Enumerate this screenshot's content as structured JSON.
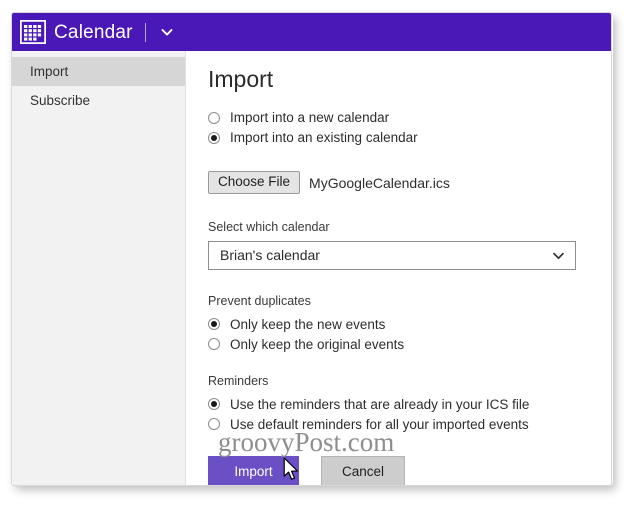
{
  "header": {
    "icon": "calendar-icon",
    "title": "Calendar",
    "caret": "chevron-down-icon"
  },
  "sidebar": {
    "items": [
      {
        "label": "Import",
        "selected": true
      },
      {
        "label": "Subscribe",
        "selected": false
      }
    ]
  },
  "main": {
    "heading": "Import",
    "import_target": {
      "options": [
        {
          "label": "Import into a new calendar",
          "selected": false
        },
        {
          "label": "Import into an existing calendar",
          "selected": true
        }
      ]
    },
    "file": {
      "button_label": "Choose File",
      "file_name": "MyGoogleCalendar.ics"
    },
    "calendar_select": {
      "label": "Select which calendar",
      "value": "Brian's calendar",
      "chevron": "chevron-down-icon"
    },
    "prevent_duplicates": {
      "label": "Prevent duplicates",
      "options": [
        {
          "label": "Only keep the new events",
          "selected": true
        },
        {
          "label": "Only keep the original events",
          "selected": false
        }
      ]
    },
    "reminders": {
      "label": "Reminders",
      "options": [
        {
          "label": "Use the reminders that are already in your ICS file",
          "selected": true
        },
        {
          "label": "Use default reminders for all your imported events",
          "selected": false
        }
      ]
    },
    "actions": {
      "import_label": "Import",
      "cancel_label": "Cancel"
    }
  },
  "watermark": {
    "text": "groovyPost.com"
  },
  "colors": {
    "header_purple": "#4918b6",
    "import_button_purple": "#6b4fc4",
    "sidebar_bg": "#f2f2f2",
    "sidebar_selected": "#d6d6d6",
    "cancel_gray": "#cdcdcd"
  }
}
